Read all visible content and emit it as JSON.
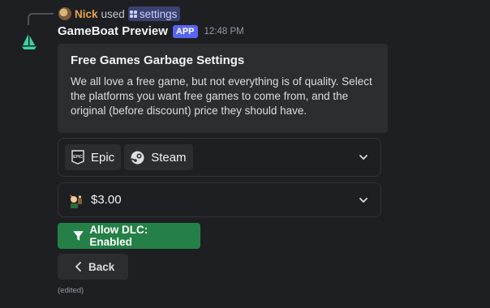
{
  "reply": {
    "username": "Nick",
    "used_text": "used",
    "command": "settings"
  },
  "message": {
    "author": "GameBoat Preview",
    "badge": "APP",
    "timestamp": "12:48 PM",
    "edited_label": "(edited)"
  },
  "embed": {
    "title": "Free Games Garbage Settings",
    "description": "We all love a free game, but not everything is of quality. Select the platforms you want free games to come from, and the original (before discount) price they should have."
  },
  "platform_select": {
    "options": [
      {
        "label": "Epic",
        "icon": "epic-games-icon"
      },
      {
        "label": "Steam",
        "icon": "steam-icon"
      }
    ]
  },
  "price_select": {
    "value": "$3.00",
    "icon": "character-emoji-icon"
  },
  "buttons": {
    "dlc_label": "Allow DLC: Enabled",
    "back_label": "Back"
  },
  "colors": {
    "accent": "#5865f2",
    "success": "#248046",
    "bot_avatar": "#3ad5a0"
  }
}
